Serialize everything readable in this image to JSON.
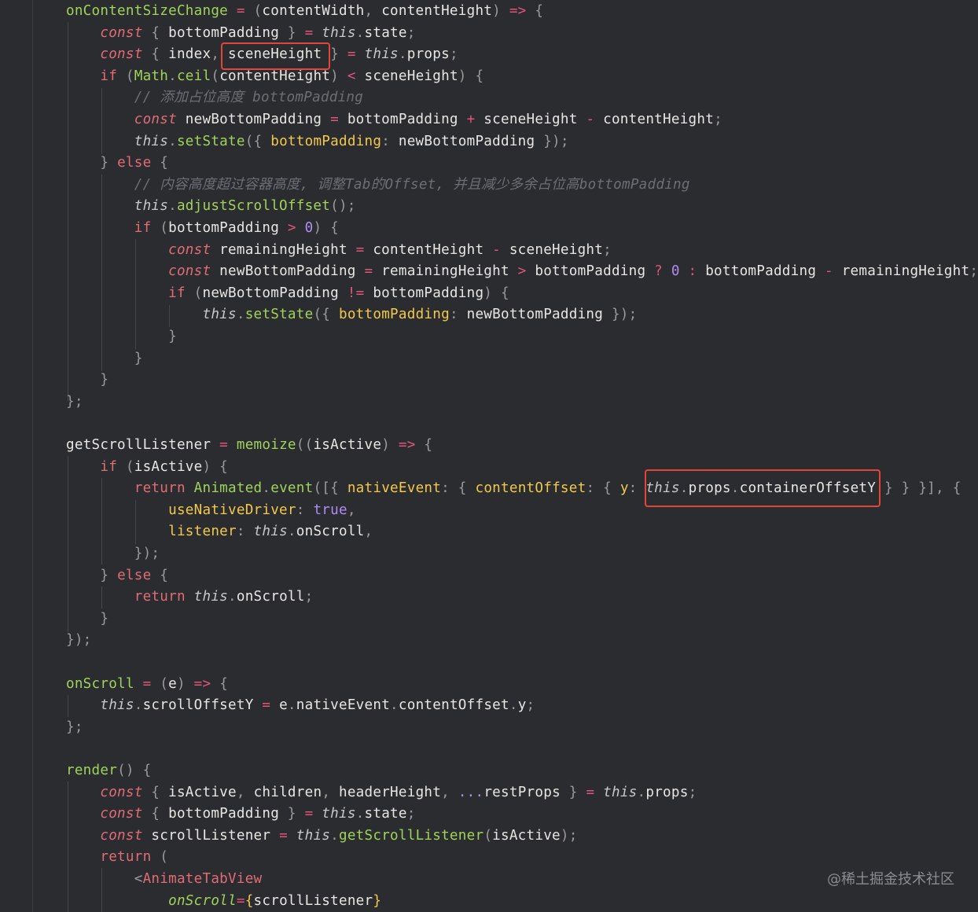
{
  "editor": {
    "lines": [
      {
        "tokens": [
          [
            "fn",
            "onContentSizeChange"
          ],
          [
            "op",
            " = "
          ],
          [
            "p",
            "("
          ],
          [
            "",
            "contentWidth"
          ],
          [
            "p",
            ", "
          ],
          [
            "",
            "contentHeight"
          ],
          [
            "p",
            ")"
          ],
          [
            "op",
            " => "
          ],
          [
            "p",
            "{"
          ]
        ]
      },
      {
        "tokens": [
          [
            "ki",
            "    const"
          ],
          [
            "p",
            " { "
          ],
          [
            "",
            "bottomPadding"
          ],
          [
            "p",
            " } "
          ],
          [
            "op",
            "= "
          ],
          [
            "st",
            "this"
          ],
          [
            "p",
            "."
          ],
          [
            "",
            "state"
          ],
          [
            "p",
            ";"
          ]
        ]
      },
      {
        "tokens": [
          [
            "ki",
            "    const"
          ],
          [
            "p",
            " { "
          ],
          [
            "",
            "index"
          ],
          [
            "p",
            ", "
          ],
          [
            "",
            "sceneHeight"
          ],
          [
            "p",
            " } "
          ],
          [
            "op",
            "= "
          ],
          [
            "st",
            "this"
          ],
          [
            "p",
            "."
          ],
          [
            "",
            "props"
          ],
          [
            "p",
            ";"
          ]
        ]
      },
      {
        "tokens": [
          [
            "k",
            "    if"
          ],
          [
            "p",
            " ("
          ],
          [
            "fn",
            "Math"
          ],
          [
            "p",
            "."
          ],
          [
            "fn",
            "ceil"
          ],
          [
            "p",
            "("
          ],
          [
            "",
            "contentHeight"
          ],
          [
            "p",
            ")"
          ],
          [
            "op",
            " < "
          ],
          [
            "",
            "sceneHeight"
          ],
          [
            "p",
            ") {"
          ]
        ]
      },
      {
        "tokens": [
          [
            "cm",
            "        // 添加占位高度 bottomPadding"
          ]
        ]
      },
      {
        "tokens": [
          [
            "ki",
            "        const"
          ],
          [
            "",
            " newBottomPadding"
          ],
          [
            "op",
            " = "
          ],
          [
            "",
            "bottomPadding"
          ],
          [
            "op",
            " + "
          ],
          [
            "",
            "sceneHeight"
          ],
          [
            "op",
            " - "
          ],
          [
            "",
            "contentHeight"
          ],
          [
            "p",
            ";"
          ]
        ]
      },
      {
        "tokens": [
          [
            "st",
            "        this"
          ],
          [
            "p",
            "."
          ],
          [
            "fn",
            "setState"
          ],
          [
            "p",
            "({ "
          ],
          [
            "pr",
            "bottomPadding"
          ],
          [
            "p",
            ": "
          ],
          [
            "",
            "newBottomPadding"
          ],
          [
            "p",
            " });"
          ]
        ]
      },
      {
        "tokens": [
          [
            "p",
            "    } "
          ],
          [
            "k",
            "else"
          ],
          [
            "p",
            " {"
          ]
        ]
      },
      {
        "tokens": [
          [
            "cm",
            "        // 内容高度超过容器高度, 调整Tab的Offset, 并且减少多余占位高bottomPadding"
          ]
        ]
      },
      {
        "tokens": [
          [
            "st",
            "        this"
          ],
          [
            "p",
            "."
          ],
          [
            "fn",
            "adjustScrollOffset"
          ],
          [
            "p",
            "();"
          ]
        ]
      },
      {
        "tokens": [
          [
            "k",
            "        if"
          ],
          [
            "p",
            " ("
          ],
          [
            "",
            "bottomPadding"
          ],
          [
            "op",
            " > "
          ],
          [
            "nm",
            "0"
          ],
          [
            "p",
            ") {"
          ]
        ]
      },
      {
        "tokens": [
          [
            "ki",
            "            const"
          ],
          [
            "",
            " remainingHeight"
          ],
          [
            "op",
            " = "
          ],
          [
            "",
            "contentHeight"
          ],
          [
            "op",
            " - "
          ],
          [
            "",
            "sceneHeight"
          ],
          [
            "p",
            ";"
          ]
        ]
      },
      {
        "tokens": [
          [
            "ki",
            "            const"
          ],
          [
            "",
            " newBottomPadding"
          ],
          [
            "op",
            " = "
          ],
          [
            "",
            "remainingHeight"
          ],
          [
            "op",
            " > "
          ],
          [
            "",
            "bottomPadding"
          ],
          [
            "op",
            " ? "
          ],
          [
            "nm",
            "0"
          ],
          [
            "op",
            " : "
          ],
          [
            "",
            "bottomPadding"
          ],
          [
            "op",
            " - "
          ],
          [
            "",
            "remainingHeight"
          ],
          [
            "p",
            ";"
          ]
        ]
      },
      {
        "tokens": [
          [
            "k",
            "            if"
          ],
          [
            "p",
            " ("
          ],
          [
            "",
            "newBottomPadding"
          ],
          [
            "op",
            " != "
          ],
          [
            "",
            "bottomPadding"
          ],
          [
            "p",
            ") {"
          ]
        ]
      },
      {
        "tokens": [
          [
            "st",
            "                this"
          ],
          [
            "p",
            "."
          ],
          [
            "fn",
            "setState"
          ],
          [
            "p",
            "({ "
          ],
          [
            "pr",
            "bottomPadding"
          ],
          [
            "p",
            ": "
          ],
          [
            "",
            "newBottomPadding"
          ],
          [
            "p",
            " });"
          ]
        ]
      },
      {
        "tokens": [
          [
            "p",
            "            }"
          ]
        ]
      },
      {
        "tokens": [
          [
            "p",
            "        }"
          ]
        ]
      },
      {
        "tokens": [
          [
            "p",
            "    }"
          ]
        ]
      },
      {
        "tokens": [
          [
            "p",
            "};"
          ]
        ]
      },
      {
        "tokens": []
      },
      {
        "tokens": [
          [
            "",
            "getScrollListener"
          ],
          [
            "op",
            " = "
          ],
          [
            "fn",
            "memoize"
          ],
          [
            "p",
            "(("
          ],
          [
            "",
            "isActive"
          ],
          [
            "p",
            ")"
          ],
          [
            "op",
            " => "
          ],
          [
            "p",
            "{"
          ]
        ]
      },
      {
        "tokens": [
          [
            "k",
            "    if"
          ],
          [
            "p",
            " ("
          ],
          [
            "",
            "isActive"
          ],
          [
            "p",
            ") {"
          ]
        ]
      },
      {
        "tokens": [
          [
            "k",
            "        return"
          ],
          [
            "fn",
            " Animated"
          ],
          [
            "p",
            "."
          ],
          [
            "fn",
            "event"
          ],
          [
            "p",
            "([{ "
          ],
          [
            "pr",
            "nativeEvent"
          ],
          [
            "p",
            ": { "
          ],
          [
            "pr",
            "contentOffset"
          ],
          [
            "p",
            ": { "
          ],
          [
            "pr",
            "y"
          ],
          [
            "p",
            ": "
          ],
          [
            "st",
            "this"
          ],
          [
            "p",
            "."
          ],
          [
            "",
            "props"
          ],
          [
            "p",
            "."
          ],
          [
            "",
            "containerOffsetY"
          ],
          [
            "p",
            " } } }], {"
          ]
        ]
      },
      {
        "tokens": [
          [
            "pr",
            "            useNativeDriver"
          ],
          [
            "p",
            ": "
          ],
          [
            "nm",
            "true"
          ],
          [
            "p",
            ","
          ]
        ]
      },
      {
        "tokens": [
          [
            "pr",
            "            listener"
          ],
          [
            "p",
            ": "
          ],
          [
            "st",
            "this"
          ],
          [
            "p",
            "."
          ],
          [
            "",
            "onScroll"
          ],
          [
            "p",
            ","
          ]
        ]
      },
      {
        "tokens": [
          [
            "p",
            "        });"
          ]
        ]
      },
      {
        "tokens": [
          [
            "p",
            "    } "
          ],
          [
            "k",
            "else"
          ],
          [
            "p",
            " {"
          ]
        ]
      },
      {
        "tokens": [
          [
            "k",
            "        return"
          ],
          [
            "st",
            " this"
          ],
          [
            "p",
            "."
          ],
          [
            "",
            "onScroll"
          ],
          [
            "p",
            ";"
          ]
        ]
      },
      {
        "tokens": [
          [
            "p",
            "    }"
          ]
        ]
      },
      {
        "tokens": [
          [
            "p",
            "});"
          ]
        ]
      },
      {
        "tokens": []
      },
      {
        "tokens": [
          [
            "fn",
            "onScroll"
          ],
          [
            "op",
            " = "
          ],
          [
            "p",
            "("
          ],
          [
            "",
            "e"
          ],
          [
            "p",
            ")"
          ],
          [
            "op",
            " => "
          ],
          [
            "p",
            "{"
          ]
        ]
      },
      {
        "tokens": [
          [
            "st",
            "    this"
          ],
          [
            "p",
            "."
          ],
          [
            "",
            "scrollOffsetY"
          ],
          [
            "op",
            " = "
          ],
          [
            "",
            "e"
          ],
          [
            "p",
            "."
          ],
          [
            "",
            "nativeEvent"
          ],
          [
            "p",
            "."
          ],
          [
            "",
            "contentOffset"
          ],
          [
            "p",
            "."
          ],
          [
            "",
            "y"
          ],
          [
            "p",
            ";"
          ]
        ]
      },
      {
        "tokens": [
          [
            "p",
            "};"
          ]
        ]
      },
      {
        "tokens": []
      },
      {
        "tokens": [
          [
            "fn",
            "render"
          ],
          [
            "p",
            "() {"
          ]
        ]
      },
      {
        "tokens": [
          [
            "ki",
            "    const"
          ],
          [
            "p",
            " { "
          ],
          [
            "",
            "isActive"
          ],
          [
            "p",
            ", "
          ],
          [
            "",
            "children"
          ],
          [
            "p",
            ", "
          ],
          [
            "",
            "headerHeight"
          ],
          [
            "p",
            ", "
          ],
          [
            "nm",
            "..."
          ],
          [
            "",
            "restProps"
          ],
          [
            "p",
            " } "
          ],
          [
            "op",
            "= "
          ],
          [
            "st",
            "this"
          ],
          [
            "p",
            "."
          ],
          [
            "",
            "props"
          ],
          [
            "p",
            ";"
          ]
        ]
      },
      {
        "tokens": [
          [
            "ki",
            "    const"
          ],
          [
            "p",
            " { "
          ],
          [
            "",
            "bottomPadding"
          ],
          [
            "p",
            " } "
          ],
          [
            "op",
            "= "
          ],
          [
            "st",
            "this"
          ],
          [
            "p",
            "."
          ],
          [
            "",
            "state"
          ],
          [
            "p",
            ";"
          ]
        ]
      },
      {
        "tokens": [
          [
            "ki",
            "    const"
          ],
          [
            "",
            " scrollListener"
          ],
          [
            "op",
            " = "
          ],
          [
            "st",
            "this"
          ],
          [
            "p",
            "."
          ],
          [
            "fn",
            "getScrollListener"
          ],
          [
            "p",
            "("
          ],
          [
            "",
            "isActive"
          ],
          [
            "p",
            ");"
          ]
        ]
      },
      {
        "tokens": [
          [
            "k",
            "    return"
          ],
          [
            "p",
            " ("
          ]
        ]
      },
      {
        "tokens": [
          [
            "p",
            "        <"
          ],
          [
            "tg",
            "AnimateTabView"
          ]
        ]
      },
      {
        "tokens": [
          [
            "at",
            "            onScroll"
          ],
          [
            "op",
            "="
          ],
          [
            "pr",
            "{"
          ],
          [
            "",
            "scrollListener"
          ],
          [
            "pr",
            "}"
          ]
        ]
      }
    ]
  },
  "watermark": "@稀土掘金技术社区"
}
